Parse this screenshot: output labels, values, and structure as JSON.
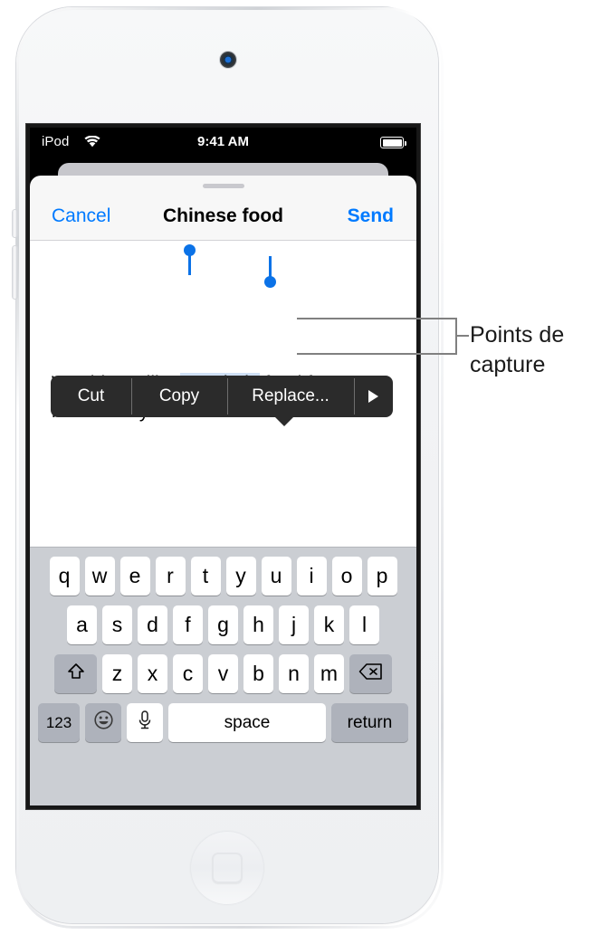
{
  "device": {
    "name": "ipod-touch",
    "camera_icon": "front-camera-icon",
    "home_button_icon": "home-button-icon"
  },
  "status_bar": {
    "carrier": "iPod",
    "wifi_icon": "wifi-icon",
    "time": "9:41 AM",
    "battery_icon": "battery-full-icon"
  },
  "compose_sheet": {
    "cancel_label": "Cancel",
    "title": "Chinese food",
    "send_label": "Send",
    "grabber_icon": "sheet-grabber-icon"
  },
  "edit_menu": {
    "items": [
      {
        "label": "Cut",
        "name": "cut"
      },
      {
        "label": "Copy",
        "name": "copy"
      },
      {
        "label": "Replace...",
        "name": "replace"
      }
    ],
    "more_icon": "chevron-right-icon"
  },
  "message": {
    "before_selection": "Would you like ",
    "selected": "Mandarin",
    "after_selection": " food for\nlunch today?",
    "selection_color": "#cfe0f5",
    "handle_color": "#0b72e7"
  },
  "keyboard": {
    "row1": [
      "q",
      "w",
      "e",
      "r",
      "t",
      "y",
      "u",
      "i",
      "o",
      "p"
    ],
    "row2": [
      "a",
      "s",
      "d",
      "f",
      "g",
      "h",
      "j",
      "k",
      "l"
    ],
    "row3": [
      "z",
      "x",
      "c",
      "v",
      "b",
      "n",
      "m"
    ],
    "shift_icon": "shift-arrow-icon",
    "delete_icon": "backspace-delete-icon",
    "numbers_label": "123",
    "emoji_icon": "smiley-emoji-icon",
    "mic_icon": "microphone-icon",
    "space_label": "space",
    "return_label": "return"
  },
  "callout": {
    "text": "Points de capture"
  },
  "colors": {
    "accent_blue": "#007aff",
    "menu_dark": "#2b2b2b",
    "keyboard_bg": "#cbced3",
    "key_dark": "#aeb2bb"
  }
}
